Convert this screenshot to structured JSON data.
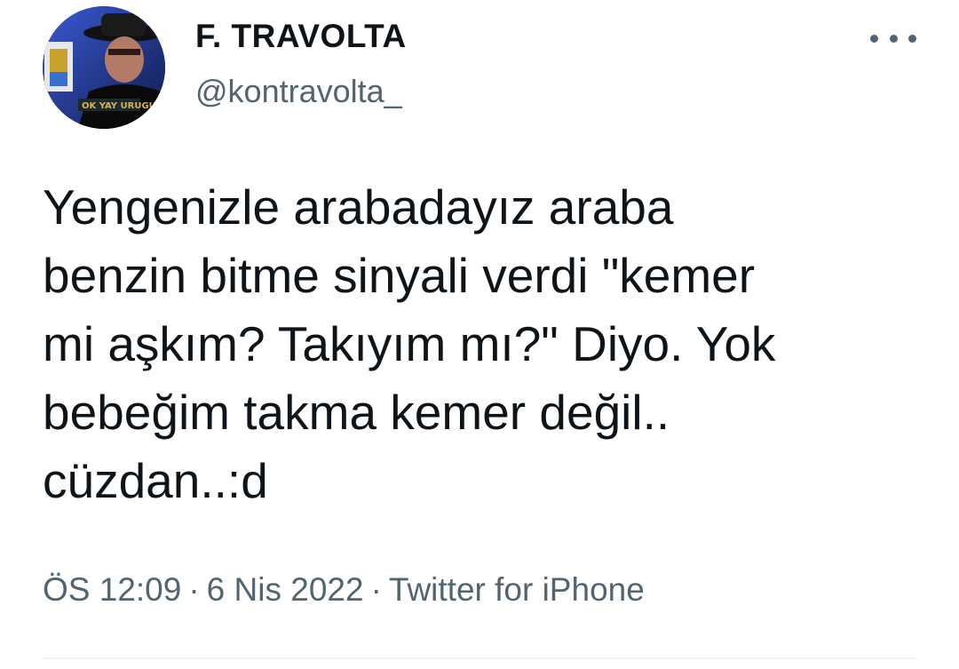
{
  "tweet": {
    "author": {
      "display_name": "F. TRAVOLTA",
      "handle": "@kontravolta_",
      "avatar_icon": "profile-photo"
    },
    "more_icon": "more-dots-icon",
    "text_lines": [
      "Yengenizle arabadayız araba",
      "benzin bitme sinyali verdi \"kemer",
      "mi aşkım? Takıyım mı?\" Diyo. Yok",
      "bebeğim takma kemer değil..",
      "cüzdan..:d"
    ],
    "meta": {
      "time": "ÖS 12:09",
      "separator": "·",
      "date": "6 Nis 2022",
      "source": "Twitter for iPhone"
    }
  },
  "colors": {
    "text_primary": "#0f1419",
    "text_secondary": "#536471",
    "divider": "#eff3f4"
  }
}
